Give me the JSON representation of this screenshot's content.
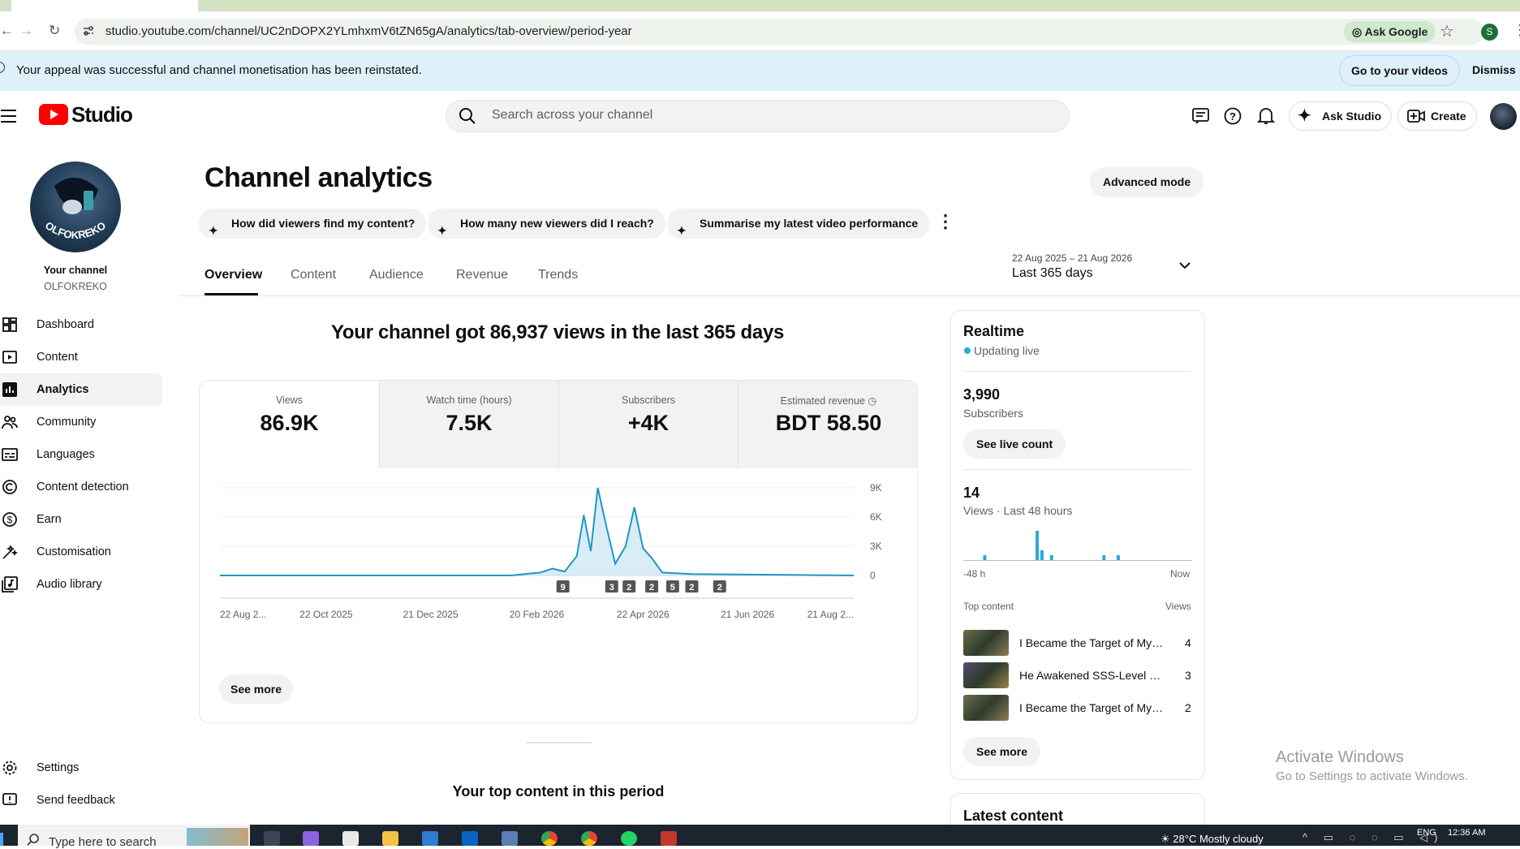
{
  "browser": {
    "url": "studio.youtube.com/channel/UC2nDOPX2YLmhxmV6tZN65gA/analytics/tab-overview/period-year",
    "ask_google": "Ask Google",
    "profile_initial": "S"
  },
  "banner": {
    "message": "Your appeal was successful and channel monetisation has been reinstated.",
    "go_to_videos": "Go to your videos",
    "dismiss": "Dismiss"
  },
  "header": {
    "logo_text": "Studio",
    "search_placeholder": "Search across your channel",
    "ask_studio": "Ask Studio",
    "create": "Create"
  },
  "sidebar": {
    "channel_label": "Your channel",
    "channel_name": "OLFOKREKO",
    "avatar_text": "OLFOKREKO",
    "items": [
      {
        "label": "Dashboard",
        "icon": "dashboard-icon"
      },
      {
        "label": "Content",
        "icon": "content-icon"
      },
      {
        "label": "Analytics",
        "icon": "analytics-icon"
      },
      {
        "label": "Community",
        "icon": "community-icon"
      },
      {
        "label": "Languages",
        "icon": "languages-icon"
      },
      {
        "label": "Content detection",
        "icon": "copyright-icon"
      },
      {
        "label": "Earn",
        "icon": "earn-icon"
      },
      {
        "label": "Customisation",
        "icon": "customisation-icon"
      },
      {
        "label": "Audio library",
        "icon": "audio-library-icon"
      }
    ],
    "settings": "Settings",
    "send_feedback": "Send feedback"
  },
  "main": {
    "title": "Channel analytics",
    "advanced_mode": "Advanced mode",
    "chips": [
      "How did viewers find my content?",
      "How many new viewers did I reach?",
      "Summarise my latest video performance"
    ],
    "tabs": [
      "Overview",
      "Content",
      "Audience",
      "Revenue",
      "Trends"
    ],
    "date_range": "22 Aug 2025 – 21 Aug 2026",
    "date_label": "Last 365 days",
    "summary": "Your channel got 86,937 views in the last 365 days",
    "metrics": [
      {
        "label": "Views",
        "value": "86.9K"
      },
      {
        "label": "Watch time (hours)",
        "value": "7.5K"
      },
      {
        "label": "Subscribers",
        "value": "+4K"
      },
      {
        "label": "Estimated revenue",
        "value": "BDT 58.50"
      }
    ],
    "see_more": "See more",
    "top_content_title": "Your top content in this period"
  },
  "realtime": {
    "title": "Realtime",
    "status": "Updating live",
    "subscribers_value": "3,990",
    "subscribers_label": "Subscribers",
    "see_live_count": "See live count",
    "views_value": "14",
    "views_label": "Views · Last 48 hours",
    "axis_start": "-48 h",
    "axis_end": "Now",
    "top_content_label": "Top content",
    "views_col_label": "Views",
    "top_content": [
      {
        "title": "I Became the Target of My I...",
        "views": "4"
      },
      {
        "title": "He Awakened SSS-Level Ex...",
        "views": "3"
      },
      {
        "title": "I Became the Target of My I...",
        "views": "2"
      }
    ],
    "see_more": "See more",
    "latest_content": "Latest content"
  },
  "watermark": {
    "title": "Activate Windows",
    "subtitle": "Go to Settings to activate Windows."
  },
  "taskbar": {
    "search": "Type here to search",
    "weather": "28°C  Mostly cloudy",
    "lang": "ENG",
    "time": "12:36 AM"
  },
  "chart_data": {
    "type": "line",
    "y_ticks": [
      "9K",
      "6K",
      "3K",
      "0"
    ],
    "ylim": [
      0,
      9000
    ],
    "x_ticks": [
      "22 Aug 2...",
      "22 Oct 2025",
      "21 Dec 2025",
      "20 Feb 2026",
      "22 Apr 2026",
      "21 Jun 2026",
      "21 Aug 2..."
    ],
    "markers": [
      "9",
      "3",
      "2",
      "2",
      "5",
      "2",
      "2"
    ],
    "series": [
      {
        "values": [
          {
            "x": "2025-08-22",
            "y": 0
          },
          {
            "x": "2026-02-05",
            "y": 0
          },
          {
            "x": "2026-02-22",
            "y": 300
          },
          {
            "x": "2026-03-01",
            "y": 700
          },
          {
            "x": "2026-03-08",
            "y": 400
          },
          {
            "x": "2026-03-15",
            "y": 2000
          },
          {
            "x": "2026-03-19",
            "y": 6200
          },
          {
            "x": "2026-03-23",
            "y": 2500
          },
          {
            "x": "2026-03-27",
            "y": 9000
          },
          {
            "x": "2026-04-01",
            "y": 5000
          },
          {
            "x": "2026-04-06",
            "y": 1200
          },
          {
            "x": "2026-04-12",
            "y": 3000
          },
          {
            "x": "2026-04-17",
            "y": 7000
          },
          {
            "x": "2026-04-22",
            "y": 2800
          },
          {
            "x": "2026-04-27",
            "y": 1800
          },
          {
            "x": "2026-05-03",
            "y": 300
          },
          {
            "x": "2026-05-20",
            "y": 150
          },
          {
            "x": "2026-06-15",
            "y": 100
          },
          {
            "x": "2026-07-15",
            "y": 60
          },
          {
            "x": "2026-08-21",
            "y": 0
          }
        ]
      }
    ],
    "realtime_bars": [
      0,
      0,
      0,
      0,
      1,
      0,
      0,
      0,
      0,
      0,
      0,
      0,
      0,
      0,
      0,
      6,
      2,
      0,
      1,
      0,
      0,
      0,
      0,
      0,
      0,
      0,
      0,
      0,
      0,
      1,
      0,
      0,
      1,
      0,
      0,
      0,
      0,
      0,
      0,
      0,
      0,
      0,
      0,
      0,
      0,
      0,
      0,
      0
    ]
  }
}
